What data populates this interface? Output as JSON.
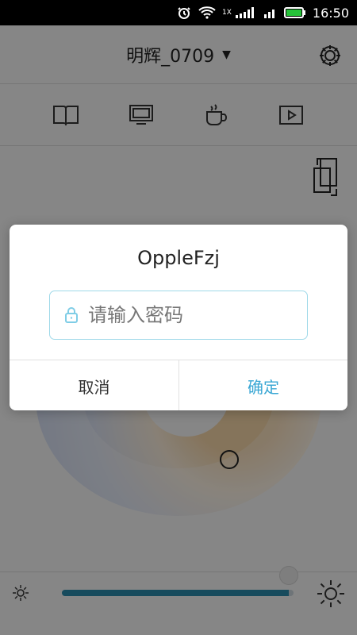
{
  "status_bar": {
    "time": "16:50",
    "network_label": "1X",
    "icons": [
      "alarm-icon",
      "wifi-icon",
      "signal-icon",
      "battery-icon"
    ]
  },
  "header": {
    "device_name": "明辉_0709",
    "dropdown_icon": "chevron-down-icon",
    "settings_icon": "gear-icon"
  },
  "tabs": [
    {
      "icon": "book-icon"
    },
    {
      "icon": "monitor-icon"
    },
    {
      "icon": "coffee-icon"
    },
    {
      "icon": "play-icon"
    }
  ],
  "content": {
    "swap_icon": "swap-icon",
    "wheel_cursor_icon": "selector-icon"
  },
  "bottom_controls": {
    "brightness_min_icon": "sun-small-icon",
    "brightness_max_icon": "sun-large-icon",
    "brightness_level": 0.98
  },
  "dialog": {
    "title": "OppleFzj",
    "lock_icon": "lock-icon",
    "password_placeholder": "请输入密码",
    "cancel_label": "取消",
    "confirm_label": "确定"
  },
  "colors": {
    "accent": "#3aa7d4",
    "slider_active": "#2a89a9",
    "input_border": "#9fd9e9"
  }
}
